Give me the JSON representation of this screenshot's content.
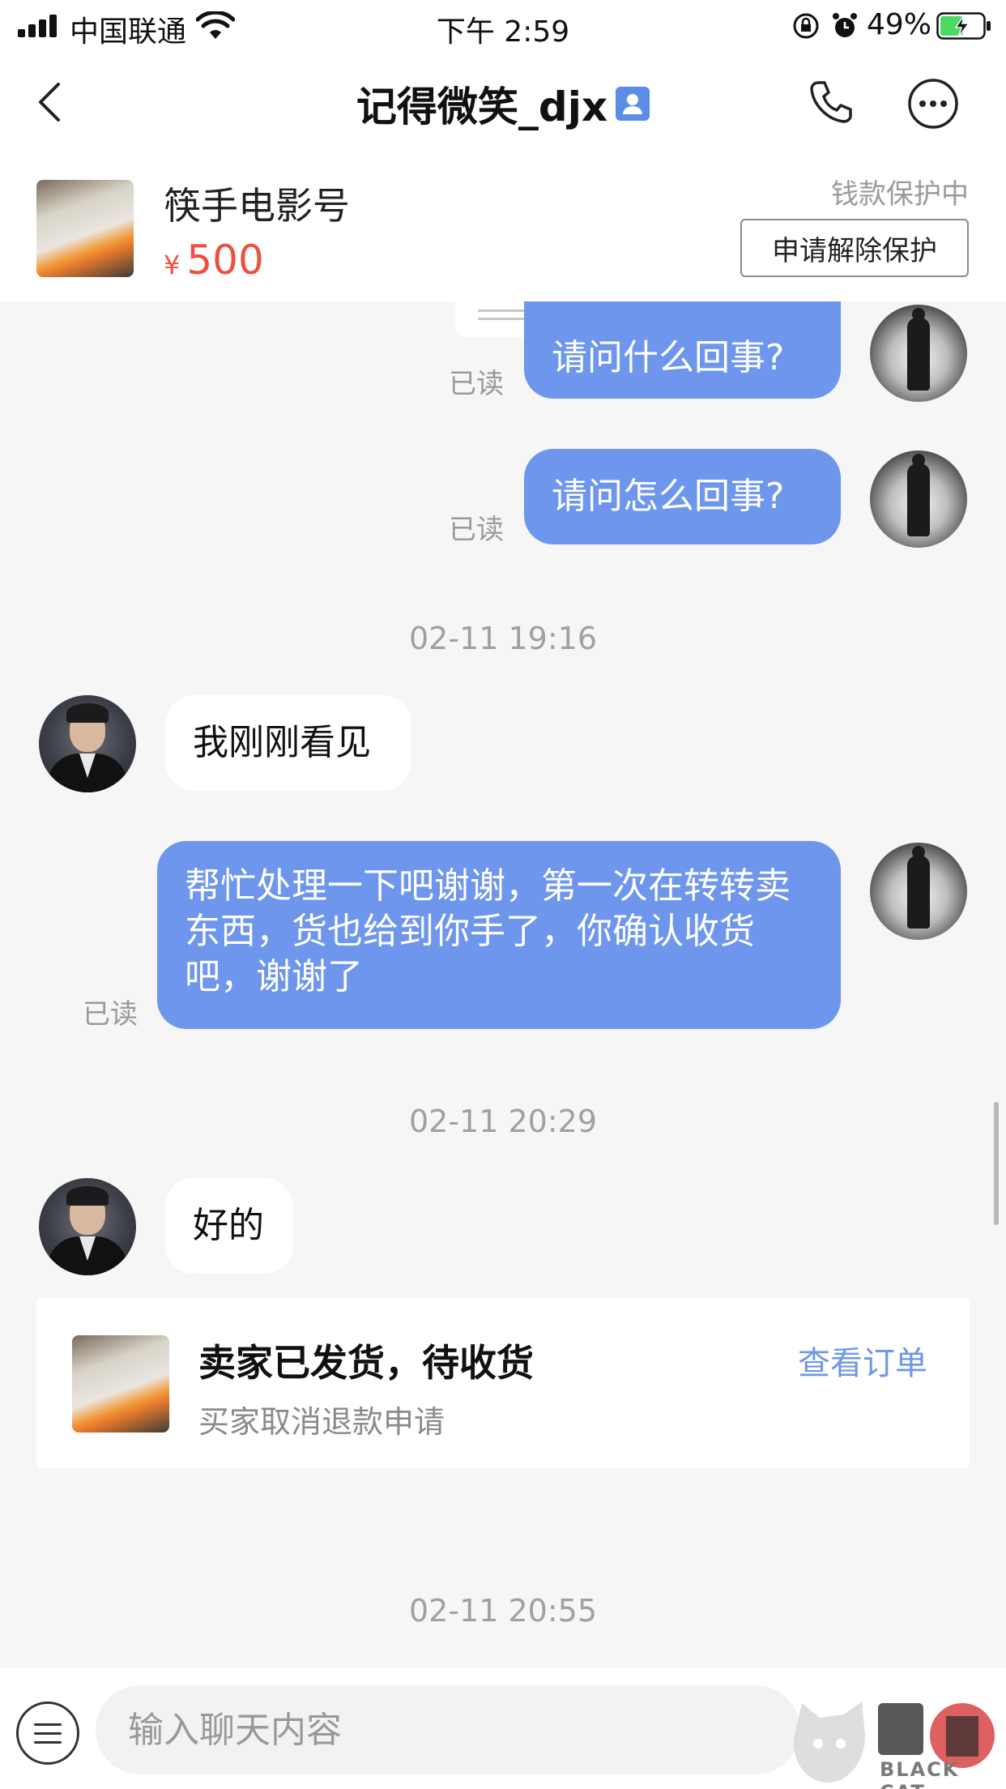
{
  "status_bar": {
    "carrier": "中国联通",
    "time": "下午 2:59",
    "battery": "49%"
  },
  "nav": {
    "title": "记得微笑_djx"
  },
  "product": {
    "name": "筷手电影号",
    "currency": "¥",
    "price": "500",
    "protection_status": "钱款保护中",
    "release_button": "申请解除保护"
  },
  "messages": {
    "m1": {
      "text": "请问什么回事?",
      "read": "已读"
    },
    "m2": {
      "text": "请问怎么回事?",
      "read": "已读"
    },
    "ts1": "02-11 19:16",
    "m3": {
      "text": "我刚刚看见"
    },
    "m4": {
      "text": "帮忙处理一下吧谢谢，第一次在转转卖东西，货也给到你手了，你确认收货吧，谢谢了",
      "read": "已读"
    },
    "ts2": "02-11 20:29",
    "m5": {
      "text": "好的"
    },
    "ts3": "02-11 20:55"
  },
  "order_card": {
    "status": "卖家已发货，待收货",
    "sub": "买家取消退款申请",
    "link": "查看订单"
  },
  "input": {
    "placeholder": "输入聊天内容"
  },
  "watermark": {
    "text": "BLACK CAT"
  },
  "colors": {
    "accent": "#6d96ec",
    "price": "#ef4f3f"
  }
}
